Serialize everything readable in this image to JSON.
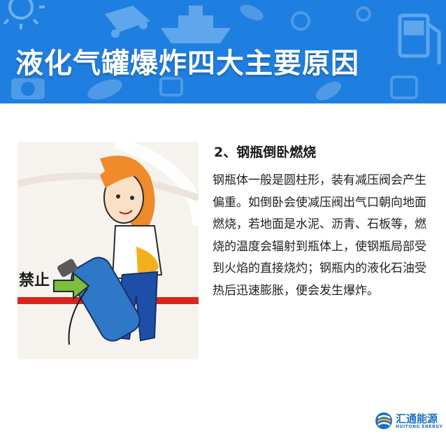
{
  "banner": {
    "title": "液化气罐爆炸四大主要原因",
    "bg_color": "#1f7fe0",
    "deco_icons": [
      "sun-icon",
      "ship-icon",
      "fuel-pump-icon",
      "car-icon",
      "camera-icon",
      "leaf-icon"
    ]
  },
  "illustration": {
    "sign_text": "禁止",
    "description_icons": [
      "gas-cylinder-icon",
      "person-icon",
      "arrow-icon"
    ]
  },
  "section": {
    "heading": "2、钢瓶倒卧燃烧",
    "body": "钢瓶体一般是圆柱形，装有减压阀会产生偏重。如倒卧会使减压阀出气口朝向地面燃烧，若地面是水泥、沥青、石板等，燃烧的温度会辐射到瓶体上，使钢瓶局部受到火焰的直接烧灼；钢瓶内的液化石油受热后迅速膨胀，便会发生爆炸。"
  },
  "logo": {
    "name_cn": "汇通能源",
    "name_en": "HUITONG ENERGY",
    "color": "#1f6fc4"
  }
}
